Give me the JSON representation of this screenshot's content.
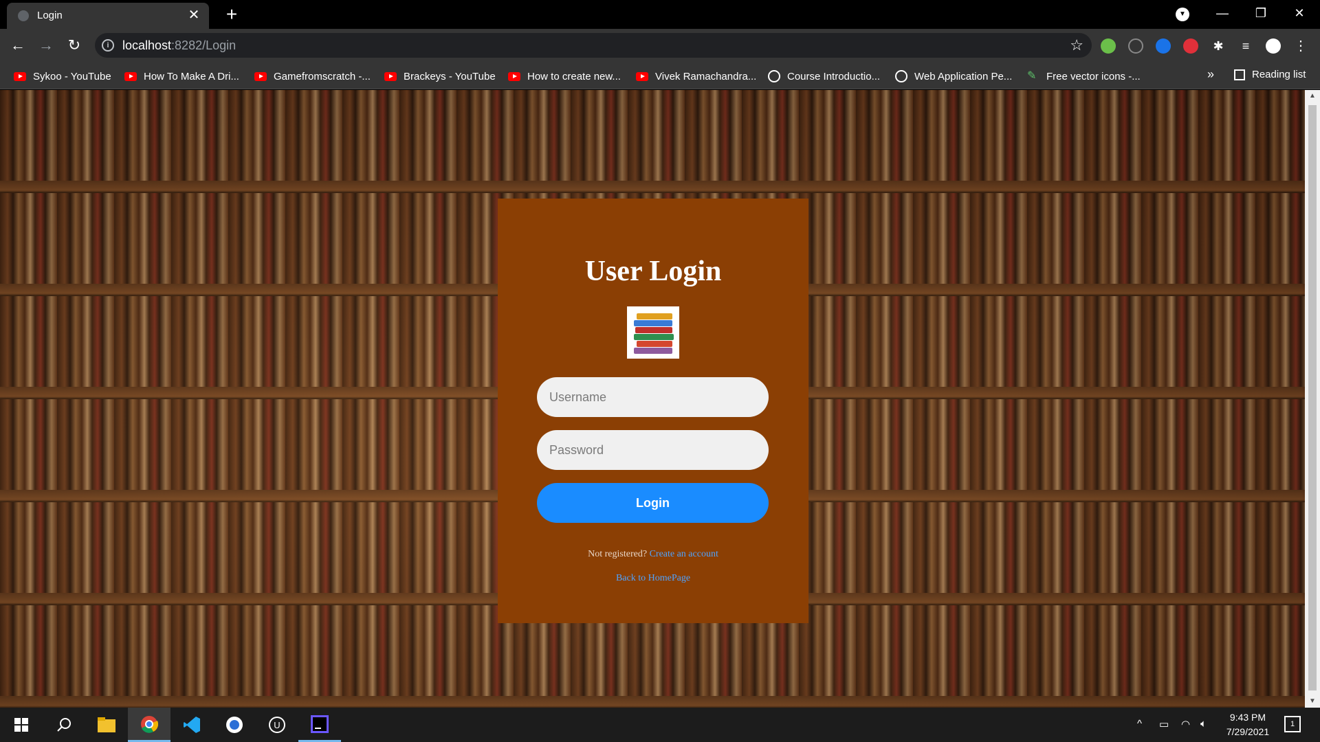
{
  "browser": {
    "tab_title": "Login",
    "url_host": "localhost",
    "url_path": ":8282/Login",
    "bookmarks": [
      {
        "label": "Sykoo - YouTube",
        "icon": "youtube-icon"
      },
      {
        "label": "How To Make A Dri...",
        "icon": "youtube-icon"
      },
      {
        "label": "Gamefromscratch -...",
        "icon": "youtube-icon"
      },
      {
        "label": "Brackeys - YouTube",
        "icon": "youtube-icon"
      },
      {
        "label": "How to create new...",
        "icon": "youtube-icon"
      },
      {
        "label": "Vivek Ramachandra...",
        "icon": "youtube-icon"
      },
      {
        "label": "Course Introductio...",
        "icon": "globe-icon"
      },
      {
        "label": "Web Application Pe...",
        "icon": "globe-icon"
      },
      {
        "label": "Free vector icons -...",
        "icon": "pencil-icon"
      }
    ],
    "more_bookmarks": "»",
    "reading_list": "Reading list"
  },
  "page": {
    "title": "User Login",
    "username_placeholder": "Username",
    "password_placeholder": "Password",
    "login_button": "Login",
    "not_registered": "Not registered?",
    "create_account": "Create an account",
    "back_home": "Back to HomePage"
  },
  "taskbar": {
    "time": "9:43 PM",
    "date": "7/29/2021",
    "notifications": "1"
  },
  "colors": {
    "login_box": "#8b3f04",
    "login_button": "#1a8cff",
    "link": "#4fa3ff"
  }
}
